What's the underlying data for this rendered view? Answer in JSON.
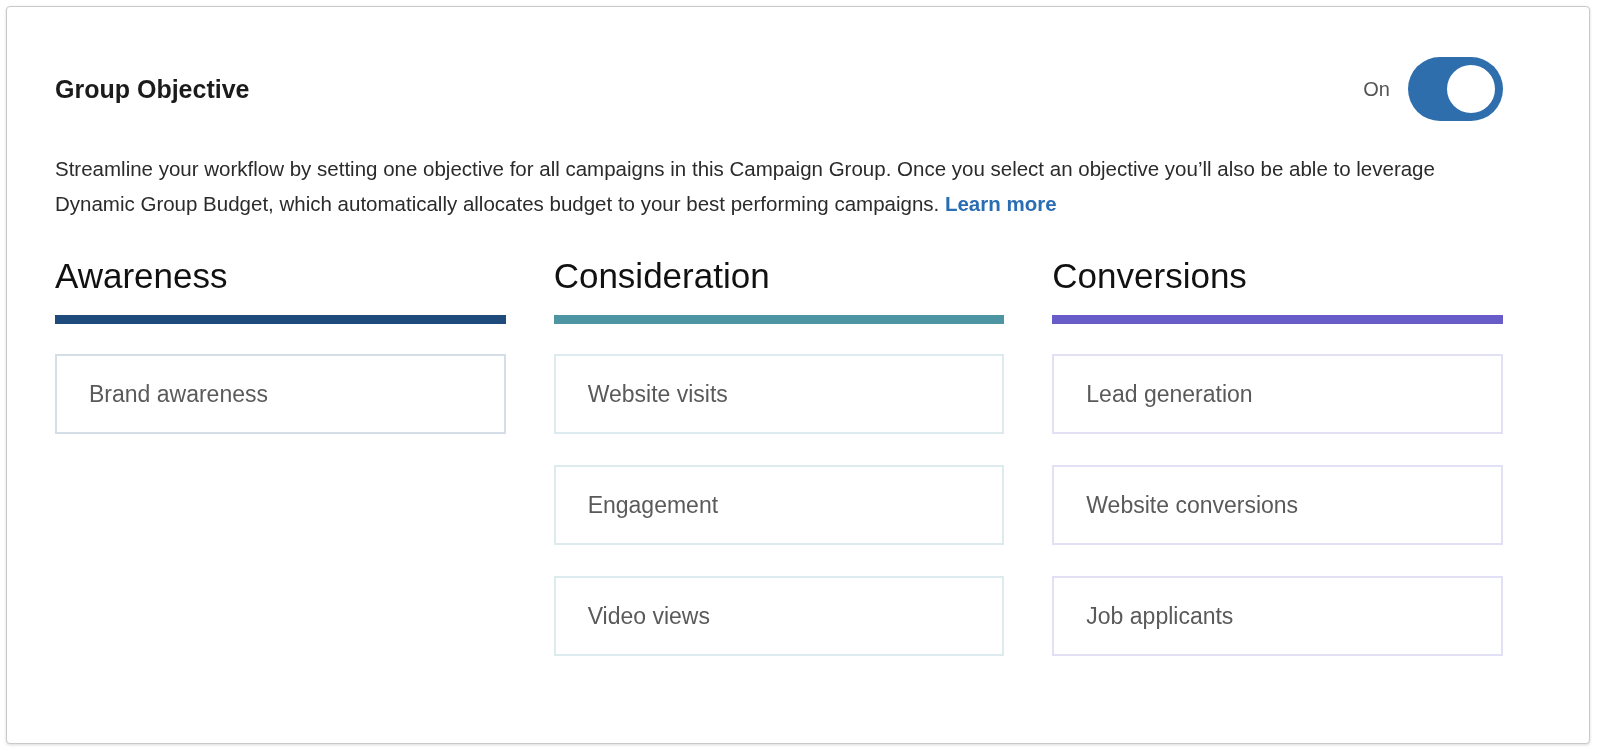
{
  "title": "Group Objective",
  "toggle": {
    "label": "On",
    "on": true
  },
  "description": "Streamline your workflow by setting one objective for all campaigns in this Campaign Group. Once you select an objective you’ll also be able to leverage Dynamic Group Budget, which automatically allocates budget to your best performing campaigns.",
  "learn_more": "Learn more",
  "categories": [
    {
      "name": "Awareness",
      "color": "#1f4a7c",
      "options": [
        "Brand awareness"
      ]
    },
    {
      "name": "Consideration",
      "color": "#4e95a3",
      "options": [
        "Website visits",
        "Engagement",
        "Video views"
      ]
    },
    {
      "name": "Conversions",
      "color": "#675cc8",
      "options": [
        "Lead generation",
        "Website conversions",
        "Job applicants"
      ]
    }
  ]
}
